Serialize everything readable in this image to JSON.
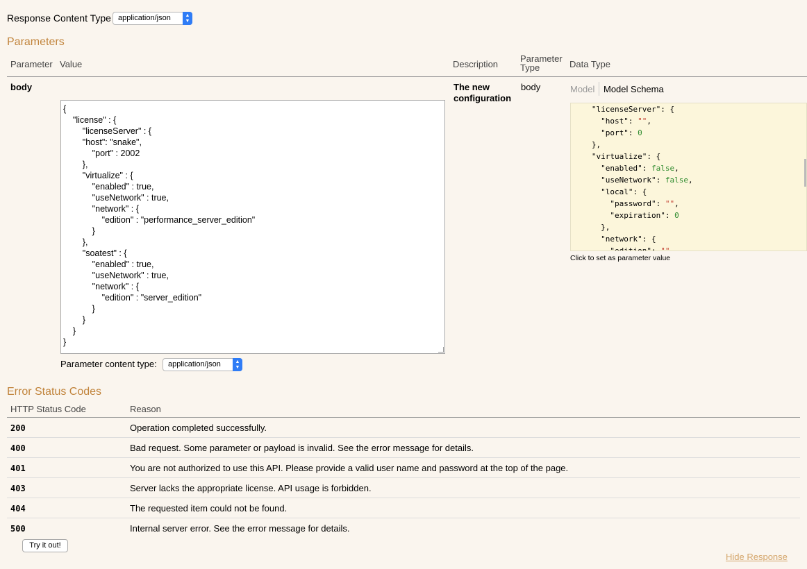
{
  "response_content_type": {
    "label": "Response Content Type",
    "selected": "application/json"
  },
  "parameters": {
    "title": "Parameters",
    "headers": {
      "parameter": "Parameter",
      "value": "Value",
      "description": "Description",
      "parameter_type_line1": "Parameter",
      "parameter_type_line2": "Type",
      "data_type": "Data Type"
    },
    "body_row": {
      "name": "body",
      "description_line1": "The new",
      "description_line2": "configuration",
      "type": "body",
      "value": "{\n    \"license\" : {\n        \"licenseServer\" : {\n        \"host\": \"snake\",\n            \"port\" : 2002\n        },\n        \"virtualize\" : {\n            \"enabled\" : true,\n            \"useNetwork\" : true,\n            \"network\" : {\n                \"edition\" : \"performance_server_edition\"\n            }\n        },\n        \"soatest\" : {\n            \"enabled\" : true,\n            \"useNetwork\" : true,\n            \"network\" : {\n                \"edition\" : \"server_edition\"\n            }\n        }\n    }\n}",
      "content_type_label": "Parameter content type:",
      "content_type_selected": "application/json"
    },
    "data_type_tabs": {
      "model": "Model",
      "model_schema": "Model Schema"
    },
    "schema_hint": "Click to set as parameter value"
  },
  "error_status": {
    "title": "Error Status Codes",
    "headers": {
      "code": "HTTP Status Code",
      "reason": "Reason"
    },
    "rows": [
      {
        "code": "200",
        "reason": "Operation completed successfully."
      },
      {
        "code": "400",
        "reason": "Bad request. Some parameter or payload is invalid. See the error message for details."
      },
      {
        "code": "401",
        "reason": "You are not authorized to use this API. Please provide a valid user name and password at the top of the page."
      },
      {
        "code": "403",
        "reason": "Server lacks the appropriate license. API usage is forbidden."
      },
      {
        "code": "404",
        "reason": "The requested item could not be found."
      },
      {
        "code": "500",
        "reason": "Internal server error. See the error message for details."
      }
    ]
  },
  "actions": {
    "try_it": "Try it out!",
    "hide_response": "Hide Response"
  },
  "colors": {
    "background": "#faf5ee",
    "section_title": "#c1843c",
    "schema_bg": "#fcf6db",
    "link": "#d4a56a",
    "select_arrow": "#2f7cf6"
  }
}
